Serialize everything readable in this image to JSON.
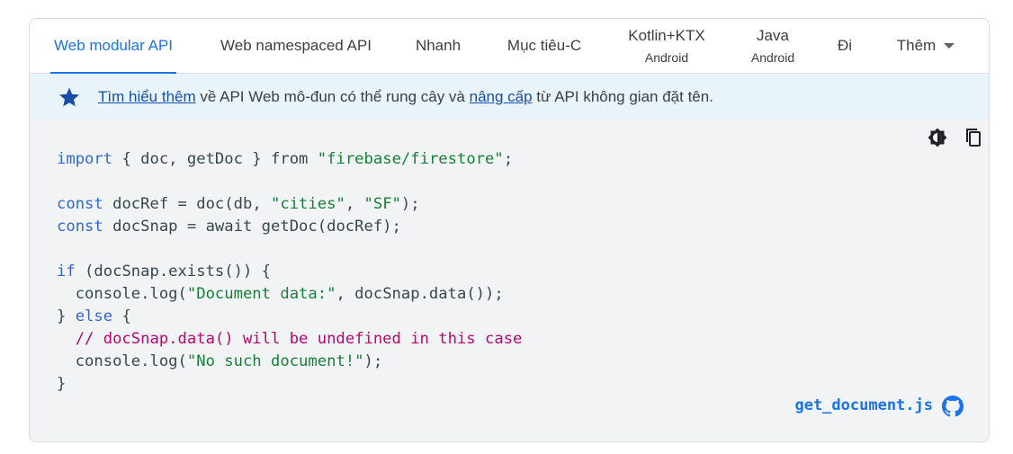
{
  "tabs": [
    {
      "label": "Web modular API",
      "sub": ""
    },
    {
      "label": "Web namespaced API",
      "sub": ""
    },
    {
      "label": "Nhanh",
      "sub": ""
    },
    {
      "label": "Mục tiêu-C",
      "sub": ""
    },
    {
      "label": "Kotlin+KTX",
      "sub": "Android"
    },
    {
      "label": "Java",
      "sub": "Android"
    },
    {
      "label": "Đi",
      "sub": ""
    },
    {
      "label": "Thêm",
      "sub": ""
    }
  ],
  "active_tab": "Web modular API",
  "notice": {
    "icon": "star-icon",
    "link1": "Tìm hiểu thêm",
    "text1": " về API Web mô-đun có thể rung cây và ",
    "link2": "nâng cấp",
    "text2": " từ API không gian đặt tên."
  },
  "code": {
    "l1_kw": "import",
    "l1_mid": " { doc, getDoc } ",
    "l1_kw2": "from",
    "l1_str": "\"firebase/firestore\"",
    "l1_end": ";",
    "l3_kw": "const",
    "l3_mid": " docRef = doc(db, ",
    "l3_str1": "\"cities\"",
    "l3_sep": ", ",
    "l3_str2": "\"SF\"",
    "l3_end": ");",
    "l4_kw": "const",
    "l4_mid": " docSnap = await getDoc(docRef);",
    "l6_kw": "if",
    "l6_mid": " (docSnap.exists()) {",
    "l7_a": "  console.log(",
    "l7_str": "\"Document data:\"",
    "l7_b": ", docSnap.data());",
    "l8_a": "} ",
    "l8_kw": "else",
    "l8_b": " {",
    "l9_cm": "  // docSnap.data() will be undefined in this case",
    "l10_a": "  console.log(",
    "l10_str": "\"No such document!\"",
    "l10_b": ");",
    "l11": "}"
  },
  "file_link": "get_document.js",
  "colors": {
    "accent": "#1a73e8",
    "keyword": "#3367d6",
    "string": "#188038",
    "comment": "#b80672"
  }
}
